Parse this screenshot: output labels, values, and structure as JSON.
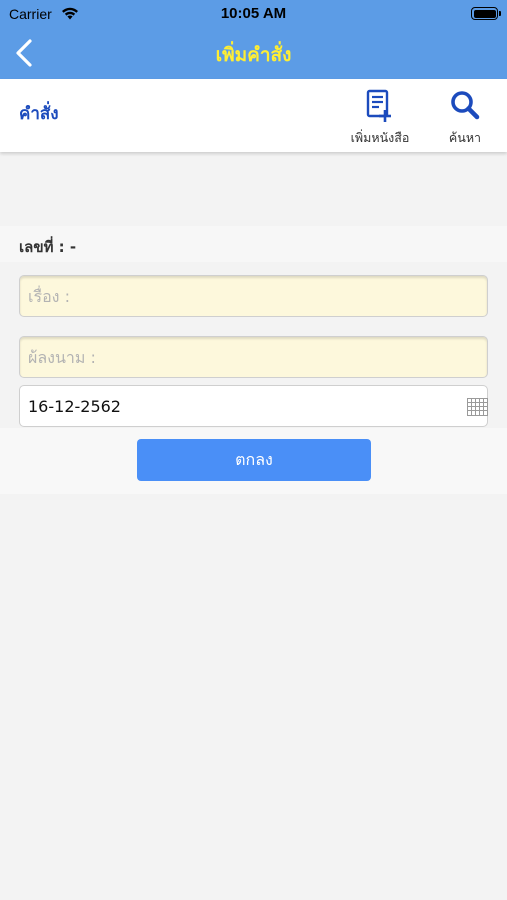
{
  "status_bar": {
    "carrier": "Carrier",
    "time": "10:05 AM"
  },
  "nav": {
    "title": "เพิ่มคำสั่ง"
  },
  "toolbar": {
    "label": "คำสั่ง",
    "add_book_label": "เพิ่มหนังสือ",
    "search_label": "ค้นหา"
  },
  "form": {
    "number_label": "เลขที่ : -",
    "subject_placeholder": "เรื่อง :",
    "subject_value": "",
    "signer_placeholder": "ผ้ลงนาม :",
    "signer_value": "",
    "date_value": "16-12-2562"
  },
  "submit_label": "ตกลง",
  "colors": {
    "nav_bg": "#5c9ce6",
    "title": "#ffee33",
    "toolbar_label": "#1c4bbd",
    "button": "#4a8ff7",
    "input_bg": "#fdf8dc"
  }
}
